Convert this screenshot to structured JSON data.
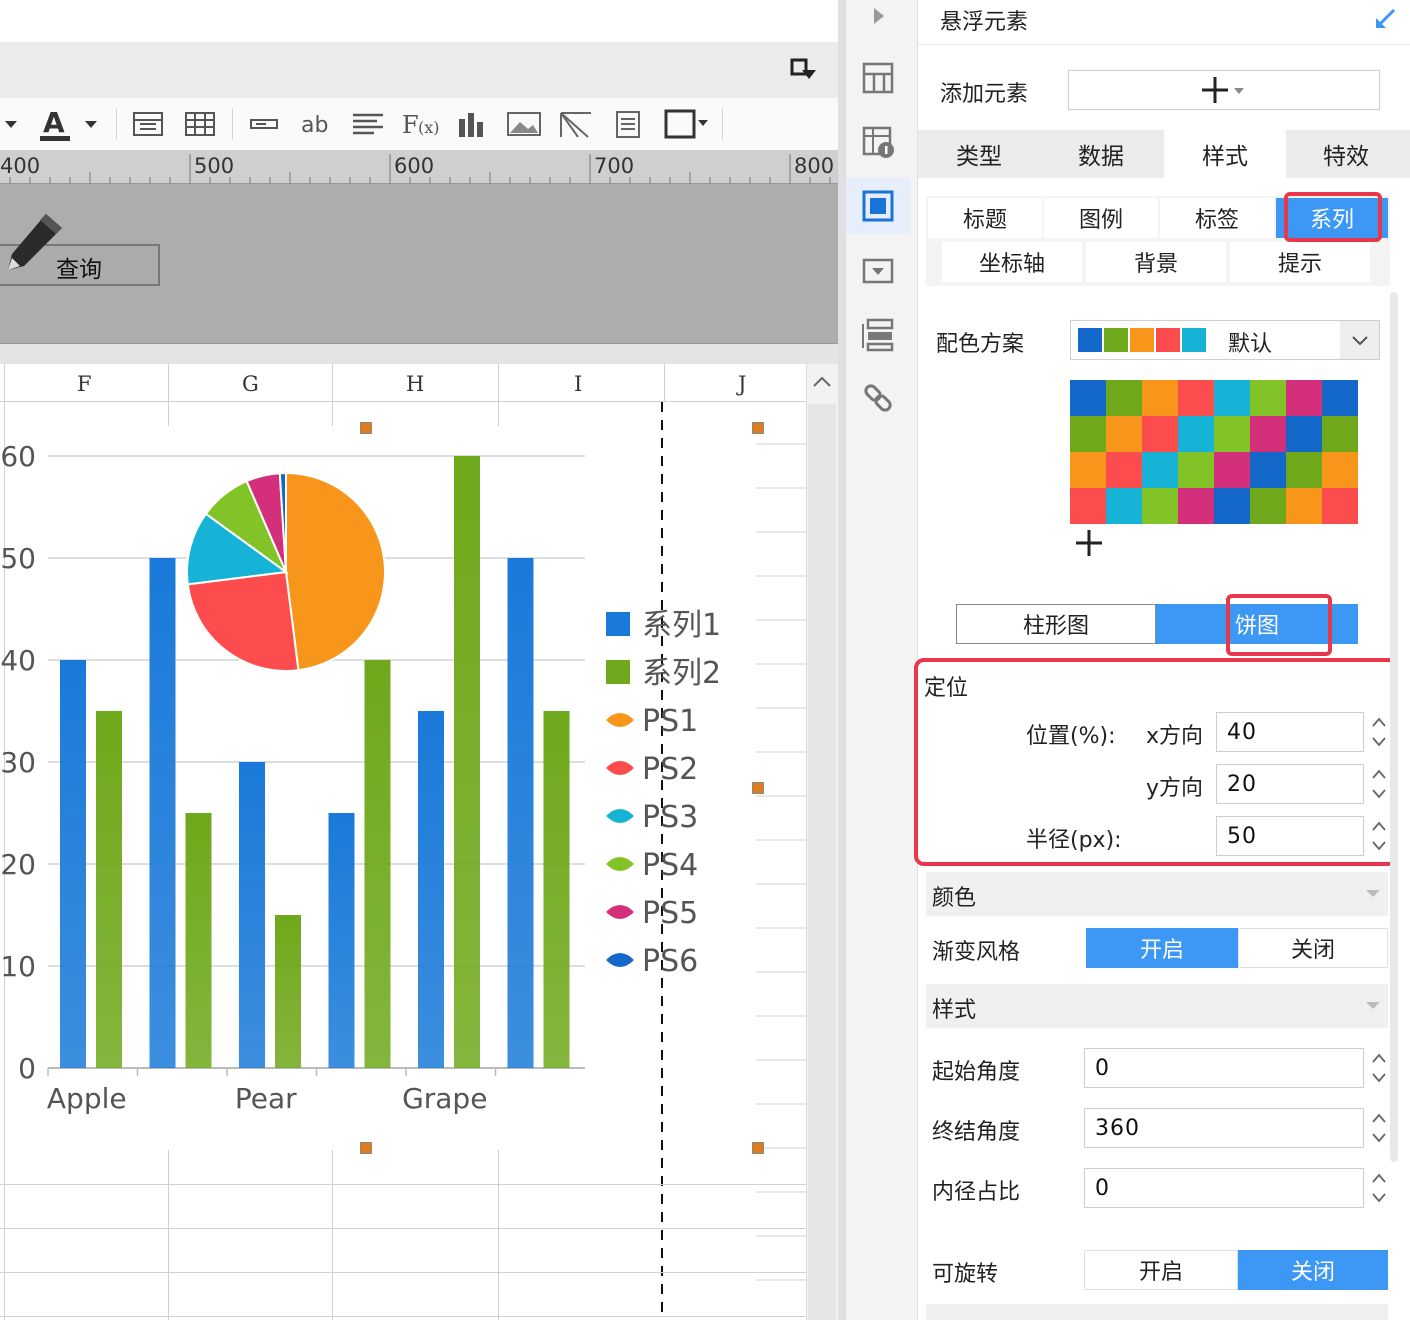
{
  "designer": {
    "ruler_labels": [
      "400",
      "500",
      "600",
      "700",
      "800"
    ],
    "query_button": "查询",
    "columns": [
      "F",
      "G",
      "H",
      "I",
      "J"
    ]
  },
  "chart_data": {
    "type": "bar",
    "categories": [
      "Apple",
      "",
      "Pear",
      "",
      "Grape",
      ""
    ],
    "x_tick_labels": [
      "Apple",
      "Pear",
      "Grape"
    ],
    "y_ticks": [
      "0",
      "10",
      "20",
      "30",
      "40",
      "50",
      "60"
    ],
    "ylim": [
      0,
      60
    ],
    "series": [
      {
        "name": "系列1",
        "values": [
          40,
          50,
          30,
          25,
          35,
          50
        ],
        "color": "#1a7ad9"
      },
      {
        "name": "系列2",
        "values": [
          35,
          25,
          15,
          40,
          60,
          35
        ],
        "color": "#6fa81a"
      }
    ],
    "pie": {
      "slices": [
        {
          "name": "PS1",
          "value": 48,
          "color": "#f7961a"
        },
        {
          "name": "PS2",
          "value": 25,
          "color": "#fc4c4e"
        },
        {
          "name": "PS3",
          "value": 12,
          "color": "#17b3d6"
        },
        {
          "name": "PS4",
          "value": 8.5,
          "color": "#82c428"
        },
        {
          "name": "PS5",
          "value": 5.5,
          "color": "#d42f7a"
        },
        {
          "name": "PS6",
          "value": 1,
          "color": "#1368c9"
        }
      ]
    },
    "legend": [
      "系列1",
      "系列2",
      "PS1",
      "PS2",
      "PS3",
      "PS4",
      "PS5",
      "PS6"
    ],
    "legend_position": "right"
  },
  "panel": {
    "header": "悬浮元素",
    "add_element_label": "添加元素",
    "tabs": [
      "类型",
      "数据",
      "样式",
      "特效"
    ],
    "active_tab": "样式",
    "subtabs_row1": [
      "标题",
      "图例",
      "标签",
      "系列"
    ],
    "subtabs_row2": [
      "坐标轴",
      "背景",
      "提示"
    ],
    "active_subtab": "系列",
    "color_scheme_label": "配色方案",
    "color_scheme_value": "默认",
    "scheme_colors": [
      "#1368c9",
      "#6fa81a",
      "#f7961a",
      "#fc4c4e",
      "#17b3d6"
    ],
    "palette": [
      [
        "#1368c9",
        "#6fa81a",
        "#f7961a",
        "#fc4c4e",
        "#17b3d6",
        "#82c428",
        "#d42f7a",
        "#1368c9"
      ],
      [
        "#6fa81a",
        "#f7961a",
        "#fc4c4e",
        "#17b3d6",
        "#82c428",
        "#d42f7a",
        "#1368c9",
        "#6fa81a"
      ],
      [
        "#f7961a",
        "#fc4c4e",
        "#17b3d6",
        "#82c428",
        "#d42f7a",
        "#1368c9",
        "#6fa81a",
        "#f7961a"
      ],
      [
        "#fc4c4e",
        "#17b3d6",
        "#82c428",
        "#d42f7a",
        "#1368c9",
        "#6fa81a",
        "#f7961a",
        "#fc4c4e"
      ]
    ],
    "chart_type_options": [
      "柱形图",
      "饼图"
    ],
    "chart_type_selected": "饼图",
    "position": {
      "section_label": "定位",
      "position_label": "位置(%):",
      "x_label": "x方向",
      "x_value": "40",
      "y_label": "y方向",
      "y_value": "20",
      "radius_label": "半径(px):",
      "radius_value": "50"
    },
    "color_section": "颜色",
    "gradient_label": "渐变风格",
    "gradient_options": [
      "开启",
      "关闭"
    ],
    "gradient_selected": "开启",
    "style_section": "样式",
    "start_angle_label": "起始角度",
    "start_angle_value": "0",
    "end_angle_label": "终结角度",
    "end_angle_value": "360",
    "inner_radius_label": "内径占比",
    "inner_radius_value": "0",
    "rotatable_label": "可旋转",
    "rotatable_options": [
      "开启",
      "关闭"
    ],
    "rotatable_selected": "关闭"
  }
}
